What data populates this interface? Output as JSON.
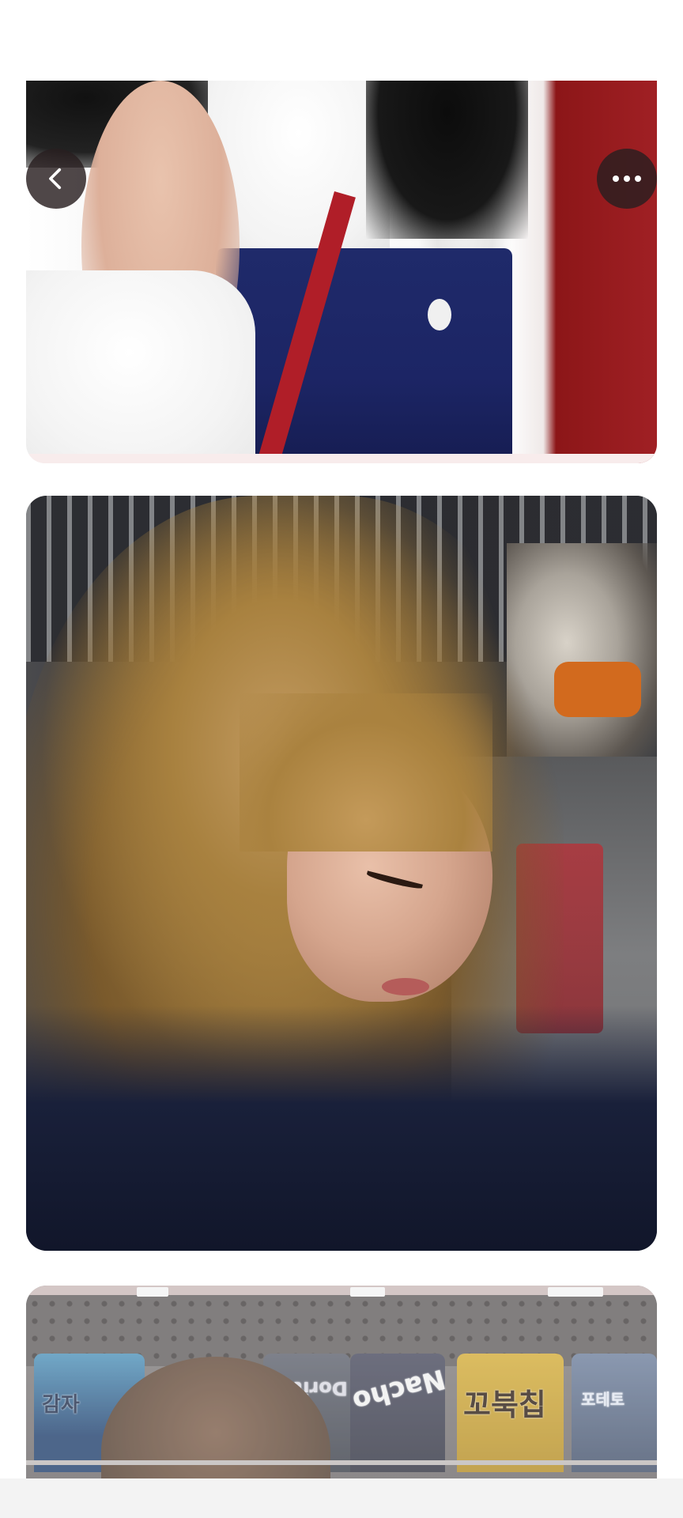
{
  "screen": {
    "background": "#ffffff"
  },
  "controls": {
    "back": {
      "icon": "chevron-left-icon",
      "color": "#ffffff"
    },
    "more": {
      "icon": "more-horizontal-icon",
      "color": "#ffffff"
    }
  },
  "photos": [
    {
      "name": "photo-1"
    },
    {
      "name": "photo-2"
    },
    {
      "name": "photo-3",
      "package_text": [
        "감자",
        "Doritos",
        "Nacho",
        "꼬북칩",
        "포테토"
      ]
    }
  ]
}
